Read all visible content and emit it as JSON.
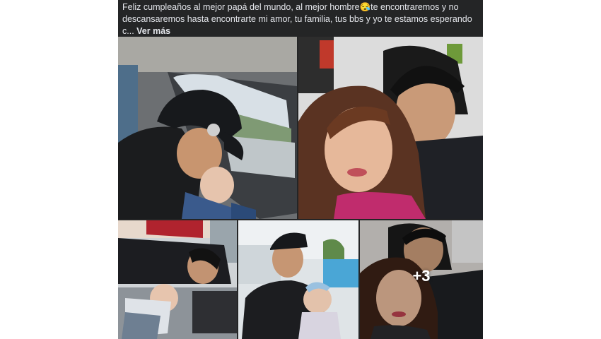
{
  "post": {
    "caption": "Feliz cumpleaños al mejor papá del mundo, al mejor hombre😪te encontraremos y no descansaremos hasta encontrarte mi amor, tu familia, tus bbs y yo te estamos esperando c... ",
    "see_more": "Ver más",
    "more_photos_count": "+3"
  },
  "colors": {
    "card_background": "#242526",
    "text": "#e4e6eb"
  }
}
